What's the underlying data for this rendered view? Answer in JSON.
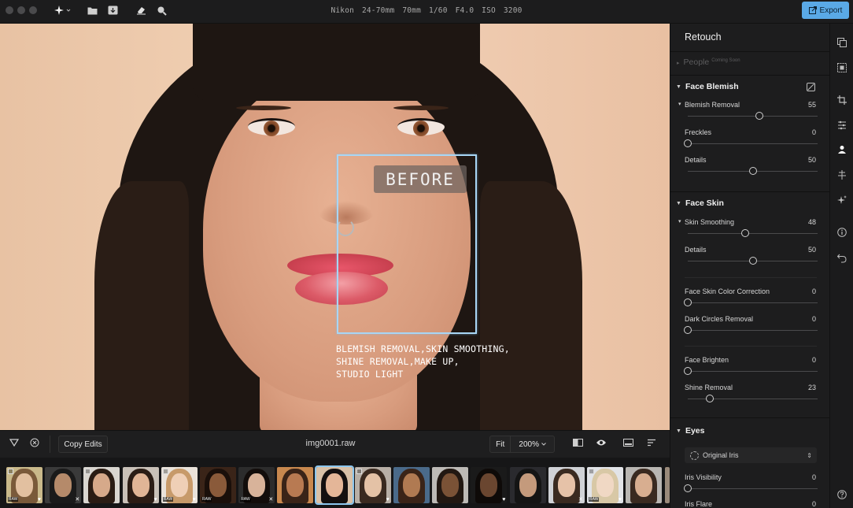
{
  "topbar": {
    "exif": {
      "lens": "Nikon 24-70mm",
      "focal": "70mm",
      "shutter": "1/60",
      "aperture": "F4.0",
      "iso": "ISO 3200"
    },
    "export_label": "Export",
    "icons": [
      "sparkle-menu-icon",
      "folder-icon",
      "import-icon",
      "eraser-icon",
      "search-icon"
    ]
  },
  "canvas": {
    "before_label": "BEFORE",
    "caption_lines": [
      "BLEMISH REMOVAL,SKIN SMOOTHING,",
      "SHINE REMOVAL,MAKE UP,",
      "STUDIO LIGHT"
    ]
  },
  "bottombar": {
    "copy_edits_label": "Copy Edits",
    "filename": "img0001.raw",
    "fit_label": "Fit",
    "zoom_label": "200%"
  },
  "filmstrip": {
    "raw_label": "RAW",
    "selected_index": 8,
    "thumbs": [
      {
        "raw": true,
        "heart": true,
        "check": true
      },
      {
        "raw": false,
        "heart": false,
        "check": false,
        "x": true
      },
      {
        "raw": false,
        "heart": false,
        "check": true
      },
      {
        "raw": false,
        "heart": true,
        "check": false
      },
      {
        "raw": true,
        "heart": true,
        "check": true
      },
      {
        "raw": true,
        "heart": false,
        "check": false
      },
      {
        "raw": true,
        "heart": false,
        "check": false,
        "x": true
      },
      {
        "raw": false,
        "heart": false,
        "check": false
      },
      {
        "raw": false,
        "heart": false,
        "check": false
      },
      {
        "raw": false,
        "heart": true,
        "check": true
      },
      {
        "raw": false,
        "heart": false,
        "check": false
      },
      {
        "raw": false,
        "heart": false,
        "check": false
      },
      {
        "raw": false,
        "heart": true,
        "check": false
      },
      {
        "raw": false,
        "heart": false,
        "check": false
      },
      {
        "raw": false,
        "heart": false,
        "check": false,
        "x": true
      },
      {
        "raw": true,
        "heart": true,
        "check": true
      },
      {
        "raw": false,
        "heart": false,
        "check": false
      }
    ]
  },
  "panel": {
    "title": "Retouch",
    "people_label": "People",
    "people_badge": "Coming Soon",
    "face_blemish": {
      "title": "Face Blemish",
      "sliders": [
        {
          "label": "Blemish Removal",
          "value": "55",
          "level": 0.55,
          "sub": true
        },
        {
          "label": "Freckles",
          "value": "0",
          "level": 0.0,
          "sub": false
        },
        {
          "label": "Details",
          "value": "50",
          "level": 0.5,
          "sub": false
        }
      ]
    },
    "face_skin": {
      "title": "Face Skin",
      "sliders": [
        {
          "label": "Skin Smoothing",
          "value": "48",
          "level": 0.44,
          "sub": true
        },
        {
          "label": "Details",
          "value": "50",
          "level": 0.5,
          "sub": false
        },
        {
          "label": "Face Skin Color Correction",
          "value": "0",
          "level": 0.0,
          "sub": false
        },
        {
          "label": "Dark Circles Removal",
          "value": "0",
          "level": 0.0,
          "sub": false
        },
        {
          "label": "Face Brighten",
          "value": "0",
          "level": 0.0,
          "sub": false
        },
        {
          "label": "Shine Removal",
          "value": "23",
          "level": 0.17,
          "sub": false
        }
      ]
    },
    "eyes": {
      "title": "Eyes",
      "iris_select": "Original Iris",
      "sliders": [
        {
          "label": "Iris Visibility",
          "value": "0",
          "level": 0.0,
          "sub": false
        },
        {
          "label": "Iris Flare",
          "value": "0",
          "level": 0.0,
          "sub": false
        }
      ]
    }
  },
  "rail": {
    "icons": [
      "layers-icon",
      "select-icon",
      "crop-icon",
      "adjust-icon",
      "portrait-icon",
      "transform-icon",
      "ai-sparkle-icon",
      "info-icon",
      "undo-icon",
      "help-icon"
    ]
  }
}
